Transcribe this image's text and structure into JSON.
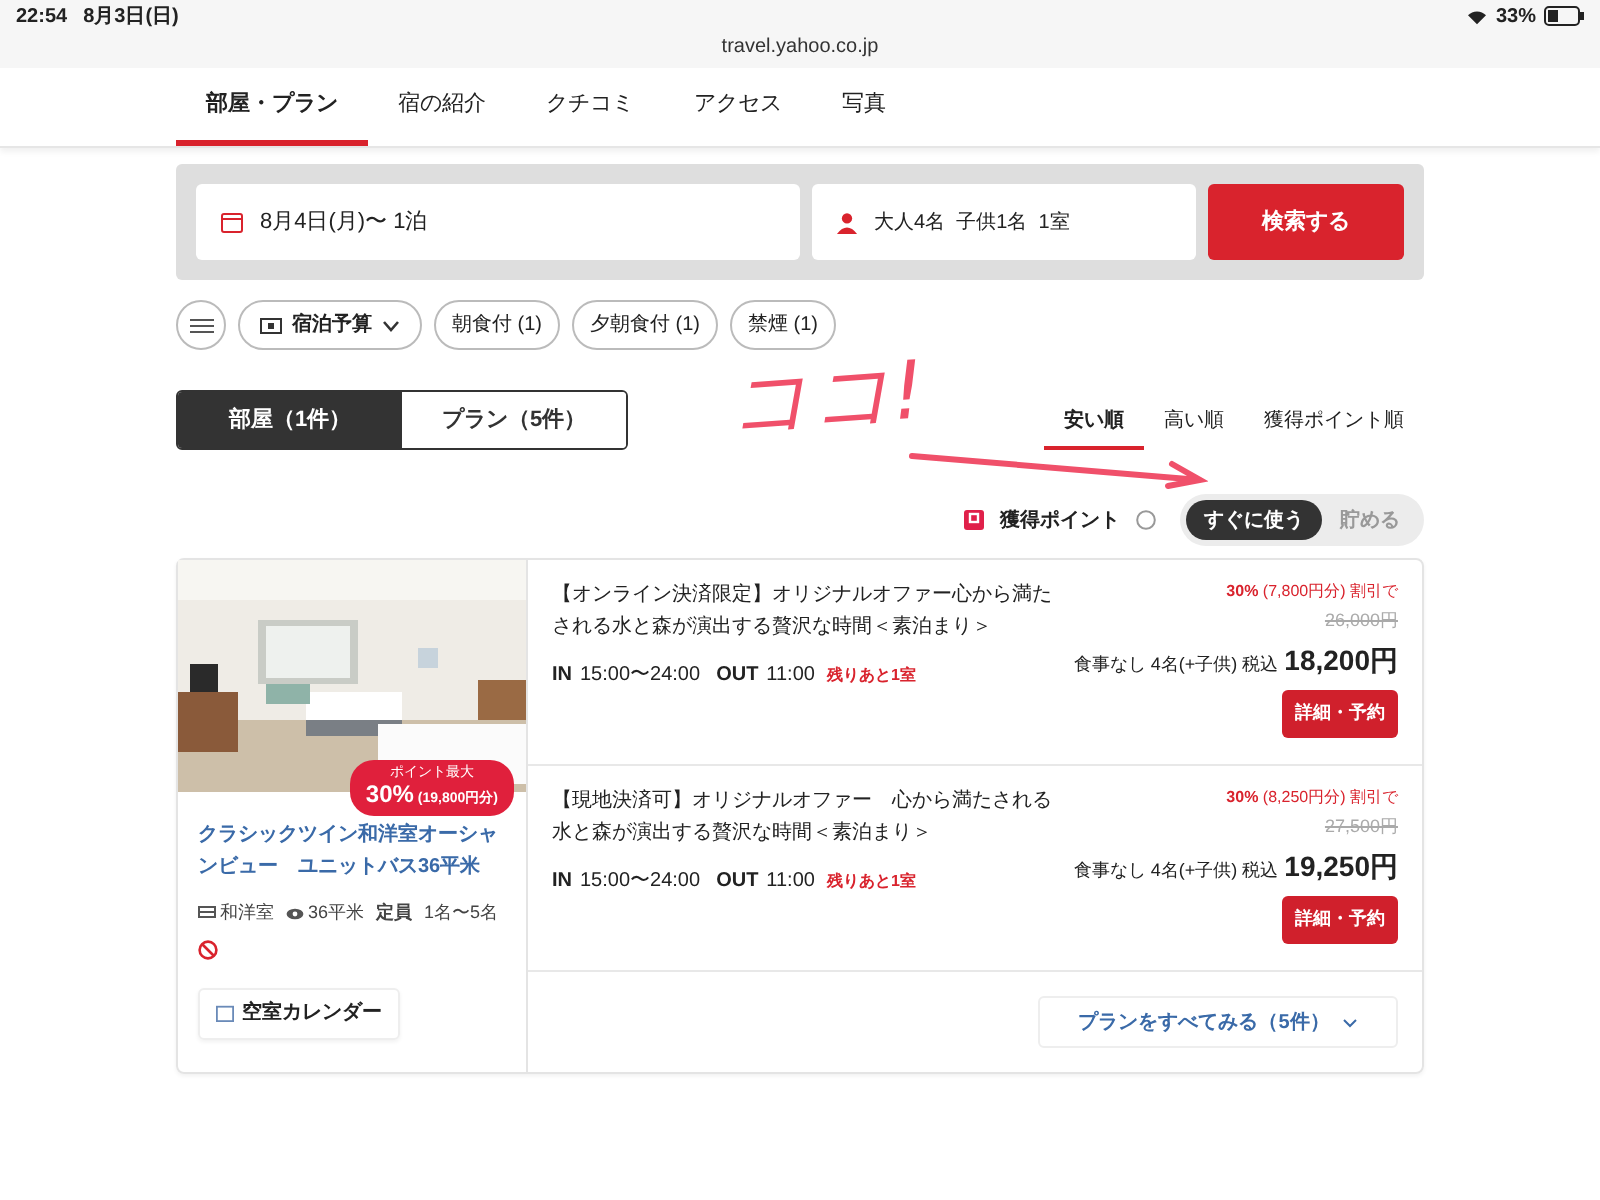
{
  "status_bar": {
    "time": "22:54",
    "date": "8月3日(日)",
    "battery": "33%",
    "url": "travel.yahoo.co.jp"
  },
  "nav_tabs": [
    {
      "label": "部屋・プラン",
      "selected": true
    },
    {
      "label": "宿の紹介",
      "selected": false
    },
    {
      "label": "クチコミ",
      "selected": false
    },
    {
      "label": "アクセス",
      "selected": false
    },
    {
      "label": "写真",
      "selected": false
    }
  ],
  "search": {
    "date": "8月4日(月)〜 1泊",
    "guests": "大人4名  子供1名  1室",
    "button": "検索する"
  },
  "filters": [
    {
      "kind": "dropdown",
      "label": "宿泊予算"
    },
    {
      "kind": "chip",
      "label": "朝食付 (1)"
    },
    {
      "kind": "chip",
      "label": "夕朝食付 (1)"
    },
    {
      "kind": "chip",
      "label": "禁煙 (1)"
    }
  ],
  "view_toggle": [
    {
      "label": "部屋（1件）",
      "selected": true
    },
    {
      "label": "プラン（5件）",
      "selected": false
    }
  ],
  "sort_tabs": [
    {
      "label": "安い順",
      "selected": true
    },
    {
      "label": "高い順",
      "selected": false
    },
    {
      "label": "獲得ポイント順",
      "selected": false
    }
  ],
  "annotation": {
    "text": "ココ!"
  },
  "points": {
    "label": "獲得ポイント",
    "options": [
      {
        "label": "すぐに使う",
        "selected": true
      },
      {
        "label": "貯める",
        "selected": false
      }
    ]
  },
  "room": {
    "badge_title": "ポイント最大",
    "badge_rate": "30%",
    "badge_amount": "(19,800円分)",
    "name": "クラシックツイン和洋室オーシャンビュー　ユニットバス36平米",
    "type": "和洋室",
    "area": "36平米",
    "capacity_label": "定員",
    "capacity": "1名〜5名",
    "calendar_button": "空室カレンダー"
  },
  "plans": [
    {
      "title": "【オンライン決済限定】オリジナルオファー心から満たされる水と森が演出する贅沢な時間＜素泊まり＞",
      "in_label": "IN",
      "in_time": "15:00〜24:00",
      "out_label": "OUT",
      "out_time": "11:00",
      "remaining": "残りあと1室",
      "discount_rate": "30%",
      "discount_detail": "(7,800円分) 割引で",
      "original_price": "26,000円",
      "conditions": "食事なし 4名(+子供) 税込",
      "price": "18,200円",
      "button": "詳細・予約"
    },
    {
      "title": "【現地決済可】オリジナルオファー　心から満たされる水と森が演出する贅沢な時間＜素泊まり＞",
      "in_label": "IN",
      "in_time": "15:00〜24:00",
      "out_label": "OUT",
      "out_time": "11:00",
      "remaining": "残りあと1室",
      "discount_rate": "30%",
      "discount_detail": "(8,250円分) 割引で",
      "original_price": "27,500円",
      "conditions": "食事なし 4名(+子供) 税込",
      "price": "19,250円",
      "button": "詳細・予約"
    }
  ],
  "see_all": "プランをすべてみる（5件）"
}
